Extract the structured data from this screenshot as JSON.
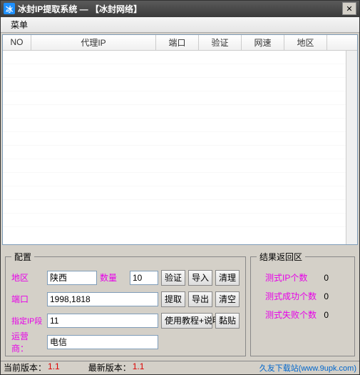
{
  "window": {
    "title": "冰封IP提取系统 — 【冰封网络】",
    "icon_text": "冰"
  },
  "menubar": {
    "menu": "菜单"
  },
  "table": {
    "headers": {
      "no": "NO",
      "ip": "代理IP",
      "port": "端口",
      "verify": "验证",
      "speed": "网速",
      "region": "地区"
    }
  },
  "config": {
    "legend": "配置",
    "region_label": "地区",
    "region_value": "陕西",
    "count_label": "数量",
    "count_value": "10",
    "port_label": "端口",
    "port_value": "1998,1818",
    "iprange_label": "指定IP段",
    "iprange_value": "11",
    "isp_label": "运营商：",
    "isp_value": "电信",
    "buttons": {
      "verify": "验证",
      "import": "导入",
      "clear1": "清理",
      "extract": "提取",
      "export": "导出",
      "clear2": "清空",
      "tutorial": "使用教程+说明",
      "paste": "黏贴"
    }
  },
  "result": {
    "legend": "结果返回区",
    "test_ip_label": "测式IP个数",
    "test_ip_value": "0",
    "test_ok_label": "测式成功个数",
    "test_ok_value": "0",
    "test_fail_label": "测式失败个数",
    "test_fail_value": "0"
  },
  "statusbar": {
    "current_label": "当前版本：",
    "current_value": "1.1",
    "latest_label": "最新版本：",
    "latest_value": "1.1",
    "watermark": "久友下载站(www.9upk.com)"
  }
}
